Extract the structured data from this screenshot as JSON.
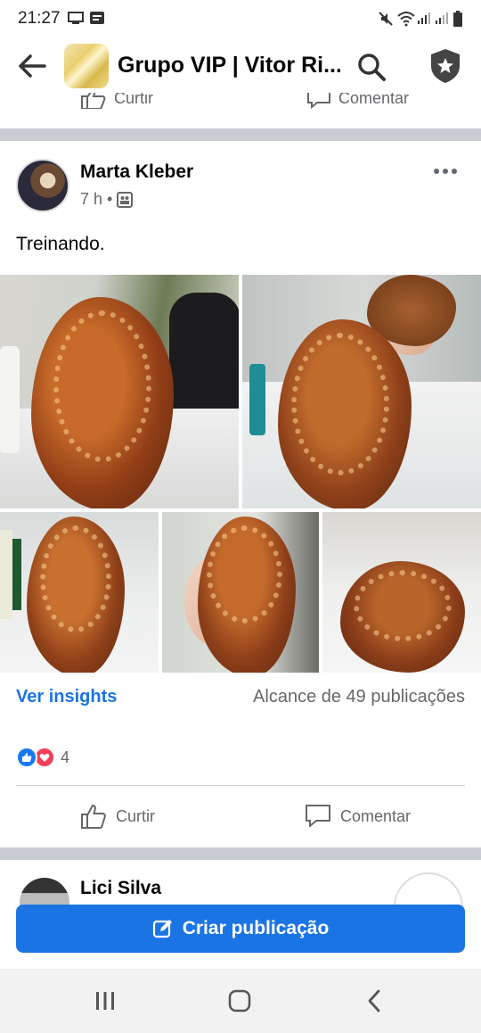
{
  "status_bar": {
    "time": "21:27",
    "icons": [
      "cast-icon",
      "notification-icon",
      "mute-icon",
      "wifi-icon",
      "signal-icon",
      "signal-icon",
      "battery-icon"
    ]
  },
  "app_bar": {
    "title": "Grupo VIP | Vitor Ri...",
    "icons": [
      "back-arrow-icon",
      "search-icon",
      "admin-shield-icon"
    ]
  },
  "previous_post": {
    "like_label": "Curtir",
    "comment_label": "Comentar"
  },
  "post": {
    "author": "Marta Kleber",
    "time": "7 h",
    "separator": "•",
    "privacy_icon": "group-members-icon",
    "text": "Treinando.",
    "photo_count": 5,
    "ver_insights": "Ver insights",
    "reach": "Alcance de 49 publicações",
    "reactions": {
      "types": [
        "like",
        "love"
      ],
      "count": "4"
    },
    "actions": {
      "like": "Curtir",
      "comment": "Comentar"
    }
  },
  "next_post": {
    "author_partial": "Lici Silva"
  },
  "create_post_button": "Criar publicação",
  "nav_bar": {
    "icons": [
      "recents-icon",
      "home-icon",
      "back-icon"
    ]
  },
  "colors": {
    "accent": "#1b74e4",
    "secondary_text": "#65676b",
    "like": "#1877f2",
    "love": "#f33e58",
    "divider": "#c9ccd1"
  }
}
